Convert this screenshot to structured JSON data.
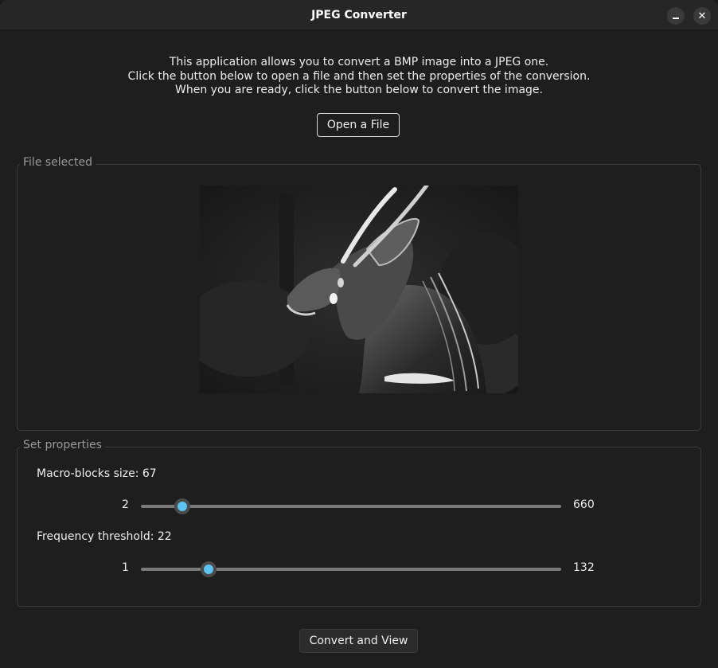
{
  "window": {
    "title": "JPEG Converter",
    "minimize_icon": "minimize-icon",
    "close_icon": "close-icon",
    "close_glyph": "✕"
  },
  "intro": {
    "line1": "This application allows you to convert a BMP image into a JPEG one.",
    "line2": "Click the button below to open a file and then set the properties of the conversion.",
    "line3": "When you are ready, click the button below to convert the image."
  },
  "open_button": {
    "label": "Open a File"
  },
  "file_frame": {
    "label": "File selected"
  },
  "properties": {
    "label": "Set properties",
    "macro_blocks": {
      "label": "Macro-blocks size: 67",
      "value": 67,
      "min": "2",
      "max": "660",
      "min_value": 2,
      "max_value": 660
    },
    "frequency": {
      "label": "Frequency threshold: 22",
      "value": 22,
      "min": "1",
      "max": "132",
      "min_value": 1,
      "max_value": 132
    }
  },
  "convert_button": {
    "label": "Convert and View"
  },
  "colors": {
    "background": "#1e1e1e",
    "accent": "#5cc4f2",
    "track": "#7a7a7a"
  }
}
